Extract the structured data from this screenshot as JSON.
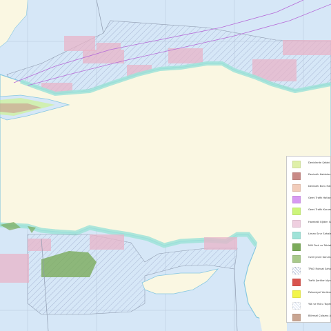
{
  "legend": {
    "items": [
      {
        "label": "Denizlerde Şafaki",
        "color": "#dff0a8",
        "pattern": "solid"
      },
      {
        "label": "Denizaltı Kabloları",
        "color": "#c98a86",
        "pattern": "solid"
      },
      {
        "label": "Denizaltı Boru Hatları",
        "color": "#f2ccba",
        "pattern": "solid"
      },
      {
        "label": "Gemi Trafik Hatları",
        "color": "#d79af2",
        "pattern": "solid"
      },
      {
        "label": "Gemi Trafik Koruma",
        "color": "#ccf57a",
        "pattern": "solid"
      },
      {
        "label": "Hareketli Eğitim Sahaları",
        "color": "#efcfe0",
        "pattern": "solid"
      },
      {
        "label": "Liman Sınır Sahaları",
        "color": "#9fe3d8",
        "pattern": "solid"
      },
      {
        "label": "Milli Park ve Tabiat",
        "color": "#7bab5a",
        "pattern": "solid"
      },
      {
        "label": "Özel Çevre Koruma",
        "color": "#a8c98a",
        "pattern": "solid"
      },
      {
        "label": "TPAO Ruhsat Sahaları",
        "color": "#ffffff",
        "pattern": "hatch"
      },
      {
        "label": "Trafik Şeritleri Ayrım",
        "color": "#d9544e",
        "pattern": "solid"
      },
      {
        "label": "Potansiyel Yenilenebilir",
        "color": "#f2f54a",
        "pattern": "solid"
      },
      {
        "label": "Yük ve Yolcu Taşıma",
        "color": "#ffffff",
        "pattern": "hatch-light"
      },
      {
        "label": "Bilimsel Çalışma Alanları",
        "color": "#c9a592",
        "pattern": "solid"
      }
    ]
  },
  "colors": {
    "sea": "#d6e7f7",
    "land": "#faf7e2",
    "coast": "#86c7e0"
  }
}
